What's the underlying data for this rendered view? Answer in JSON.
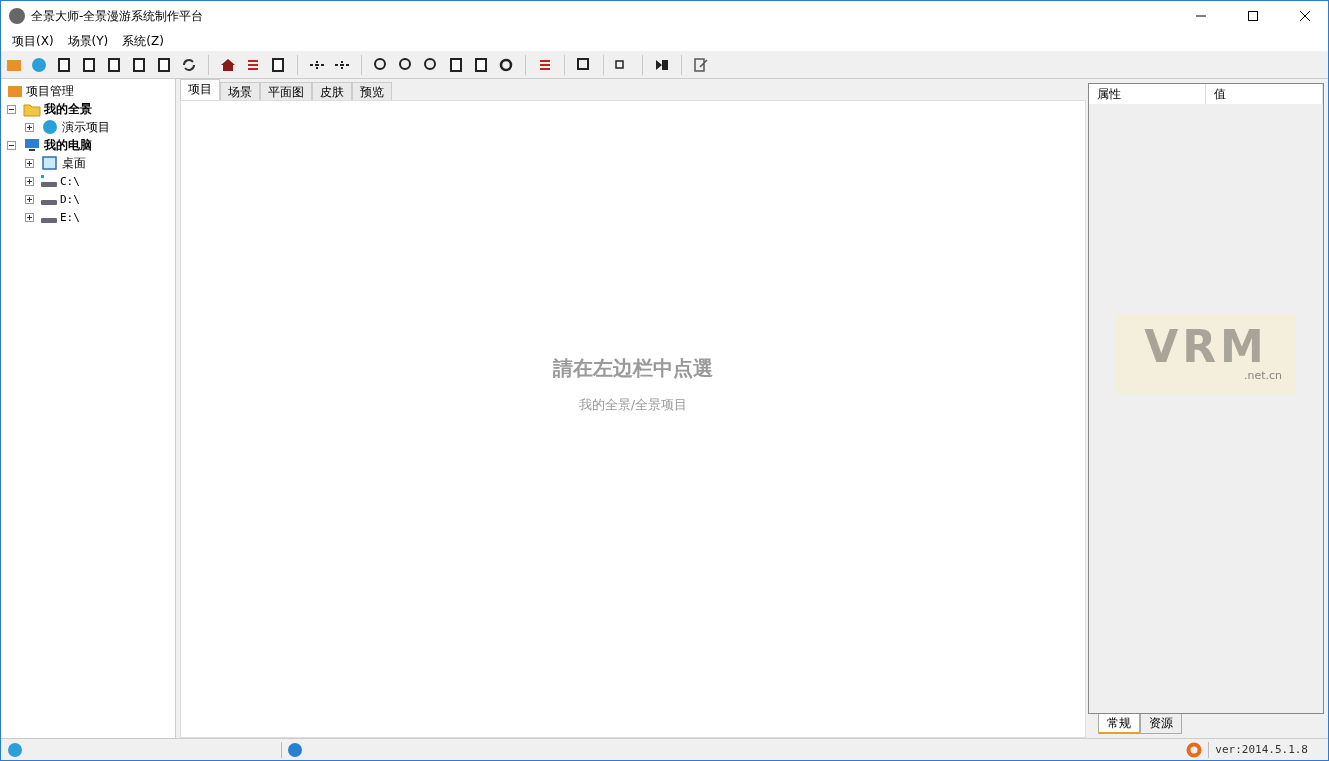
{
  "window": {
    "title": "全景大师-全景漫游系统制作平台"
  },
  "menu": [
    "项目(X)",
    "场景(Y)",
    "系统(Z)"
  ],
  "tree": {
    "root": "项目管理",
    "children": [
      {
        "label": "我的全景",
        "kind": "folder",
        "expanded": true,
        "children": [
          {
            "label": "演示项目",
            "kind": "panorama",
            "expanded": false
          }
        ]
      },
      {
        "label": "我的电脑",
        "kind": "computer",
        "expanded": true,
        "children": [
          {
            "label": "桌面",
            "kind": "desktop",
            "expanded": false
          },
          {
            "label": "C:\\",
            "kind": "system-drive",
            "expanded": false
          },
          {
            "label": "D:\\",
            "kind": "drive",
            "expanded": false
          },
          {
            "label": "E:\\",
            "kind": "drive",
            "expanded": false
          }
        ]
      }
    ]
  },
  "tabs": [
    {
      "label": "项目",
      "selected": true
    },
    {
      "label": "场景",
      "selected": false
    },
    {
      "label": "平面图",
      "selected": false
    },
    {
      "label": "皮肤",
      "selected": false
    },
    {
      "label": "预览",
      "selected": false
    }
  ],
  "hint": {
    "line1": "請在左边栏中点選",
    "line2": "我的全景/全景项目"
  },
  "properties": {
    "columns": [
      "属性",
      "值"
    ],
    "logo": {
      "text": "VRM",
      "subtext": ".net.cn"
    },
    "tabs": [
      {
        "label": "常规",
        "selected": true
      },
      {
        "label": "资源",
        "selected": false
      }
    ]
  },
  "status_bar": {
    "version": "ver:2014.5.1.8"
  }
}
